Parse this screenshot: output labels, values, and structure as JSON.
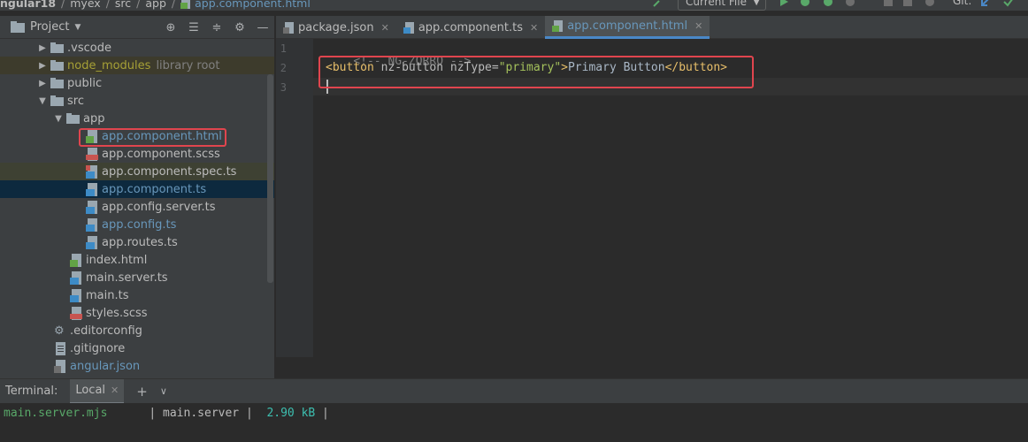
{
  "navbar": {
    "crumbs": [
      "ngular18",
      "myex",
      "src",
      "app"
    ],
    "file": "app.component.html",
    "run_config": "Current File",
    "git_label": "Git:"
  },
  "project": {
    "title": "Project",
    "tree": [
      {
        "label": "vscode_dot",
        "text": ".vscode",
        "type": "folder",
        "expand": "collapsed"
      },
      {
        "text": "node_modules",
        "type": "folder",
        "expand": "collapsed",
        "note": "library root"
      },
      {
        "text": "public",
        "type": "folder",
        "expand": "collapsed"
      },
      {
        "text": "src",
        "type": "folder",
        "expand": "expanded"
      },
      {
        "text": "app",
        "type": "folder",
        "expand": "expanded"
      },
      {
        "text": "app.component.html",
        "type": "html"
      },
      {
        "text": "app.component.scss",
        "type": "scss"
      },
      {
        "text": "app.component.spec.ts",
        "type": "ts"
      },
      {
        "text": "app.component.ts",
        "type": "ts"
      },
      {
        "text": "app.config.server.ts",
        "type": "ts"
      },
      {
        "text": "app.config.ts",
        "type": "ts"
      },
      {
        "text": "app.routes.ts",
        "type": "ts"
      },
      {
        "text": "index.html",
        "type": "html"
      },
      {
        "text": "main.server.ts",
        "type": "ts"
      },
      {
        "text": "main.ts",
        "type": "ts"
      },
      {
        "text": "styles.scss",
        "type": "scss"
      },
      {
        "text": ".editorconfig",
        "type": "config"
      },
      {
        "text": ".gitignore",
        "type": "text"
      },
      {
        "text": "angular.json",
        "type": "json"
      }
    ]
  },
  "tabs": [
    {
      "label": "package.json"
    },
    {
      "label": "app.component.ts"
    },
    {
      "label": "app.component.html"
    }
  ],
  "editor": {
    "line_numbers": [
      "1",
      "2",
      "3"
    ],
    "line1": "<!-- NG-ZORRO -->",
    "line2": {
      "open_tag": "<button",
      "attr1": " nz-button",
      "attr2": " nzType=",
      "attr2_value": "\"primary\"",
      "close_open": ">",
      "text": "Primary Button",
      "close_tag": "</button>"
    }
  },
  "terminal": {
    "title": "Terminal:",
    "tab": "Local",
    "add": "+",
    "output": {
      "file": "main.server.mjs",
      "sep1": "      | ",
      "name": "main.server",
      "sep2": " |  ",
      "size": "2.90 kB",
      "sep3": " |"
    }
  },
  "colors": {
    "highlight_box": "#e0454e",
    "accent": "#4a88c7"
  }
}
